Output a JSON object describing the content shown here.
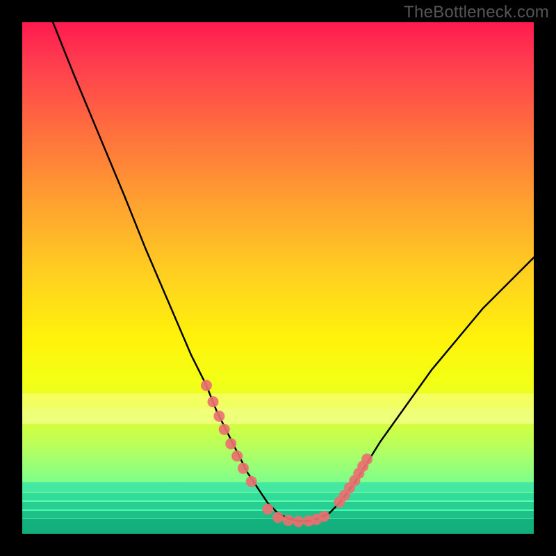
{
  "watermark": "TheBottleneck.com",
  "chart_data": {
    "type": "line",
    "title": "",
    "xlabel": "",
    "ylabel": "",
    "xlim": [
      0,
      100
    ],
    "ylim": [
      0,
      100
    ],
    "series": [
      {
        "name": "bottleneck-curve",
        "x": [
          6,
          10,
          15,
          20,
          24,
          27,
          30,
          33,
          36,
          38,
          40,
          42,
          44,
          46,
          48,
          50,
          52,
          54,
          56,
          58,
          60,
          62,
          65,
          70,
          75,
          80,
          85,
          90,
          95,
          100
        ],
        "y": [
          100,
          90,
          78,
          66,
          56,
          49,
          42,
          35,
          29,
          24,
          20,
          16,
          12,
          9,
          6,
          4,
          3,
          2.5,
          2.5,
          3,
          4,
          6,
          10,
          18,
          25,
          32,
          38,
          44,
          49,
          54
        ]
      }
    ],
    "markers": {
      "name": "data-points",
      "color": "#e97070",
      "left_cluster_x": [
        36.0,
        37.3,
        38.5,
        39.5,
        40.8,
        42.0,
        43.2,
        44.8
      ],
      "left_cluster_y": [
        29.0,
        25.8,
        23.0,
        20.4,
        17.6,
        15.2,
        12.8,
        10.2
      ],
      "valley_x": [
        48.0,
        50.0,
        52.0,
        54.0,
        56.0,
        57.5,
        59.0
      ],
      "valley_y": [
        4.8,
        3.2,
        2.6,
        2.4,
        2.5,
        2.8,
        3.4
      ],
      "right_cluster_x": [
        62.0,
        63.0,
        64.0,
        65.0,
        65.8,
        66.6,
        67.4
      ],
      "right_cluster_y": [
        6.2,
        7.5,
        9.0,
        10.4,
        11.8,
        13.2,
        14.6
      ]
    },
    "bottom_bands": [
      {
        "top_pct": 72.5,
        "height_pct": 3.0,
        "color": "#feff8e",
        "alpha": 0.55
      },
      {
        "top_pct": 75.5,
        "height_pct": 3.0,
        "color": "#fdffb0",
        "alpha": 0.55
      },
      {
        "top_pct": 90.0,
        "height_pct": 1.8,
        "color": "#3fe6a3",
        "alpha": 0.9
      },
      {
        "top_pct": 92.0,
        "height_pct": 1.5,
        "color": "#2fd79a",
        "alpha": 0.9
      },
      {
        "top_pct": 93.8,
        "height_pct": 1.5,
        "color": "#25c98f",
        "alpha": 0.9
      },
      {
        "top_pct": 95.5,
        "height_pct": 1.5,
        "color": "#1cb984",
        "alpha": 0.9
      },
      {
        "top_pct": 97.2,
        "height_pct": 2.8,
        "color": "#12a878",
        "alpha": 0.9
      }
    ],
    "grid": false,
    "legend": false
  }
}
